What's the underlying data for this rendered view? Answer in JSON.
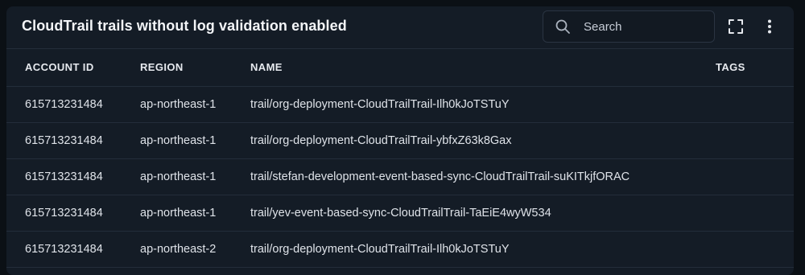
{
  "header": {
    "title": "CloudTrail trails without log validation enabled"
  },
  "search": {
    "placeholder": "Search",
    "icon": "search-icon"
  },
  "toolbar": {
    "fullscreen_icon": "fullscreen-icon",
    "more_icon": "more-vertical-icon"
  },
  "table": {
    "columns": [
      "ACCOUNT ID",
      "REGION",
      "NAME",
      "TAGS"
    ],
    "rows": [
      {
        "account_id": "615713231484",
        "region": "ap-northeast-1",
        "name": "trail/org-deployment-CloudTrailTrail-Ilh0kJoTSTuY",
        "tags": ""
      },
      {
        "account_id": "615713231484",
        "region": "ap-northeast-1",
        "name": "trail/org-deployment-CloudTrailTrail-ybfxZ63k8Gax",
        "tags": ""
      },
      {
        "account_id": "615713231484",
        "region": "ap-northeast-1",
        "name": "trail/stefan-development-event-based-sync-CloudTrailTrail-suKITkjfORAC",
        "tags": ""
      },
      {
        "account_id": "615713231484",
        "region": "ap-northeast-1",
        "name": "trail/yev-event-based-sync-CloudTrailTrail-TaEiE4wyW534",
        "tags": ""
      },
      {
        "account_id": "615713231484",
        "region": "ap-northeast-2",
        "name": "trail/org-deployment-CloudTrailTrail-Ilh0kJoTSTuY",
        "tags": ""
      }
    ]
  },
  "colors": {
    "page_background": "#0b1015",
    "panel_background": "#141c26",
    "border": "#232d3a",
    "text": "#e6e9ee"
  }
}
